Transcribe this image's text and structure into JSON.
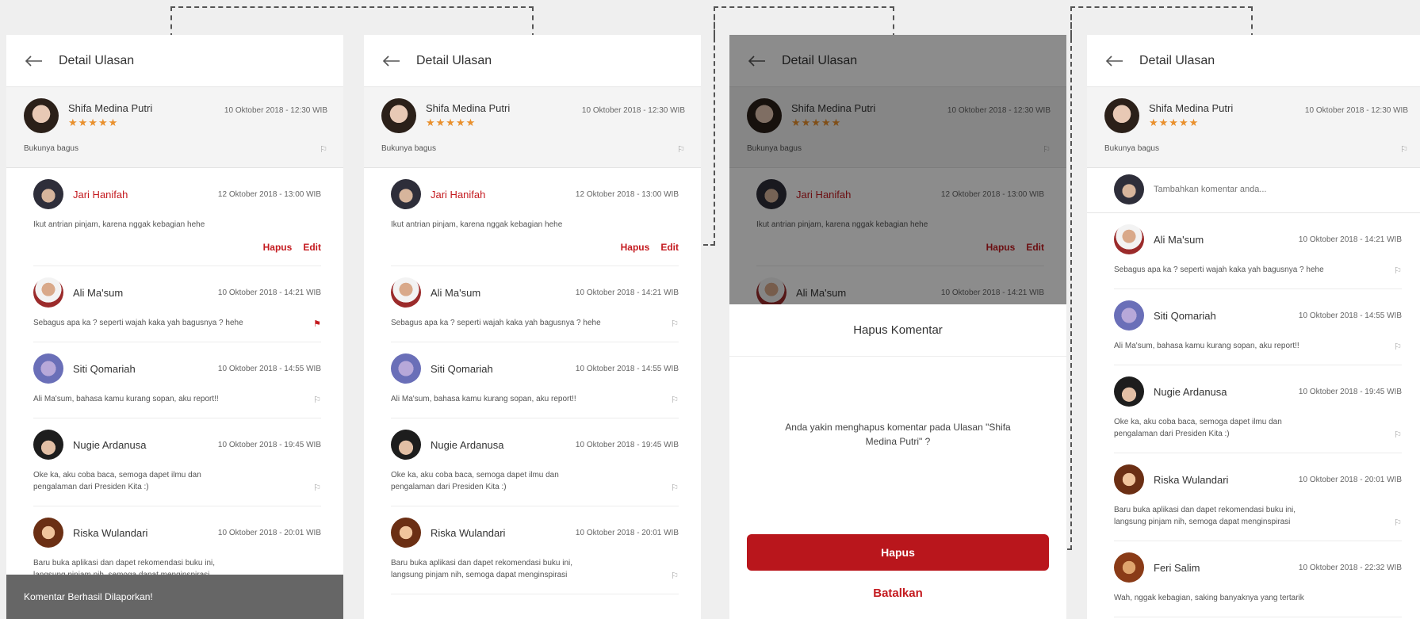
{
  "colors": {
    "accent": "#c41a1f",
    "star": "#e9902d",
    "overlay": "rgba(0,0,0,0.45)"
  },
  "header": {
    "title": "Detail Ulasan",
    "back_icon": "arrow-left-icon"
  },
  "review": {
    "author": "Shifa Medina Putri",
    "rating": 5,
    "stars": "★★★★★",
    "time": "10 Oktober 2018 - 12:30 WIB",
    "text": "Bukunya bagus"
  },
  "comments": [
    {
      "author": "Jari Hanifah",
      "time": "12 Oktober 2018 - 13:00 WIB",
      "text": "Ikut antrian pinjam, karena nggak kebagian hehe",
      "own": true
    },
    {
      "author": "Ali Ma'sum",
      "time": "10 Oktober 2018 - 14:21 WIB",
      "text": "Sebagus apa ka ? seperti wajah kaka yah bagusnya ? hehe"
    },
    {
      "author": "Siti Qomariah",
      "time": "10 Oktober 2018 - 14:55 WIB",
      "text": "Ali Ma'sum, bahasa kamu kurang sopan, aku report!!"
    },
    {
      "author": "Nugie Ardanusa",
      "time": "10 Oktober 2018 - 19:45 WIB",
      "text": "Oke ka, aku coba baca, semoga dapet ilmu dan pengalaman dari Presiden Kita :)"
    },
    {
      "author": "Riska Wulandari",
      "time": "10 Oktober 2018 - 20:01 WIB",
      "text": "Baru buka aplikasi dan dapet rekomendasi buku ini, langsung pinjam nih, semoga dapat menginspirasi"
    },
    {
      "author": "Feri Salim",
      "time": "10 Oktober 2018 - 22:32 WIB",
      "text": "Wah, nggak kebagian, saking banyaknya yang tertarik"
    }
  ],
  "actions": {
    "delete": "Hapus",
    "edit": "Edit"
  },
  "toast": "Komentar Berhasil Dilaporkan!",
  "dialog": {
    "title": "Hapus Komentar",
    "message": "Anda yakin menghapus komentar pada Ulasan \"Shifa Medina Putri\" ?",
    "confirm": "Hapus",
    "cancel": "Batalkan"
  },
  "comment_input": {
    "placeholder": "Tambahkan komentar anda..."
  }
}
